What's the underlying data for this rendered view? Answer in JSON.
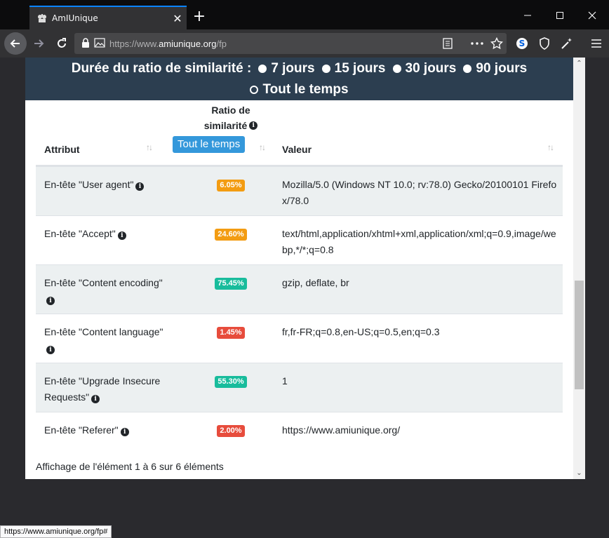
{
  "browser": {
    "tab": {
      "title": "AmIUnique"
    },
    "url": {
      "prefix": "https://www.",
      "domain": "amiunique.org",
      "path": "/fp"
    },
    "status_url": "https://www.amiunique.org/fp#"
  },
  "banner": {
    "label": "Durée du ratio de similarité :",
    "options": [
      {
        "label": "7 jours",
        "selected": false
      },
      {
        "label": "15 jours",
        "selected": false
      },
      {
        "label": "30 jours",
        "selected": false
      },
      {
        "label": "90 jours",
        "selected": false
      },
      {
        "label": "Tout le temps",
        "selected": true
      }
    ]
  },
  "table": {
    "headers": {
      "attribute": "Attribut",
      "ratio_line1": "Ratio de",
      "ratio_line2": "similarité",
      "ratio_button": "Tout le temps",
      "value": "Valeur"
    },
    "rows": [
      {
        "attribute": "En-tête \"User agent\"",
        "ratio": "6.05%",
        "ratio_color": "#f39c12",
        "value": "Mozilla/5.0 (Windows NT 10.0; rv:78.0) Gecko/20100101 Firefox/78.0"
      },
      {
        "attribute": "En-tête \"Accept\"",
        "ratio": "24.60%",
        "ratio_color": "#f39c12",
        "value": "text/html,application/xhtml+xml,application/xml;q=0.9,image/webp,*/*;q=0.8"
      },
      {
        "attribute": "En-tête \"Content encoding\"",
        "ratio": "75.45%",
        "ratio_color": "#18bc9c",
        "value": "gzip, deflate, br"
      },
      {
        "attribute": "En-tête \"Content language\"",
        "ratio": "1.45%",
        "ratio_color": "#e74c3c",
        "value": "fr,fr-FR;q=0.8,en-US;q=0.5,en;q=0.3"
      },
      {
        "attribute": "En-tête \"Upgrade Insecure Requests\"",
        "ratio": "55.30%",
        "ratio_color": "#18bc9c",
        "value": "1"
      },
      {
        "attribute": "En-tête \"Referer\"",
        "ratio": "2.00%",
        "ratio_color": "#e74c3c",
        "value": "https://www.amiunique.org/"
      }
    ],
    "footer": "Affichage de l'élément 1 à 6 sur 6 éléments"
  }
}
